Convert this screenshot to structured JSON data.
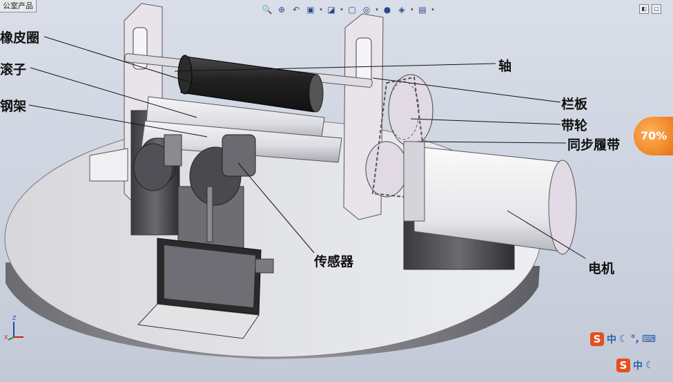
{
  "window": {
    "tab_title": "公室产品"
  },
  "toolbar": {
    "buttons": [
      {
        "icon": "zoom-to-fit-icon",
        "glyph": "🔍"
      },
      {
        "icon": "zoom-area-icon",
        "glyph": "⊕"
      },
      {
        "icon": "previous-view-icon",
        "glyph": "↶"
      },
      {
        "icon": "section-view-icon",
        "glyph": "▣"
      },
      {
        "icon": "view-orientation-icon",
        "glyph": "◪"
      },
      {
        "icon": "display-style-icon",
        "glyph": "▢"
      },
      {
        "icon": "hide-show-icon",
        "glyph": "◎"
      },
      {
        "icon": "appearance-icon",
        "glyph": "●"
      },
      {
        "icon": "scene-icon",
        "glyph": "◈"
      },
      {
        "icon": "view-settings-icon",
        "glyph": "▤"
      }
    ]
  },
  "labels": {
    "rubber_ring": "橡皮圈",
    "roller": "滚子",
    "steel_frame": "钢架",
    "shaft": "轴",
    "baffle": "栏板",
    "pulley": "带轮",
    "timing_belt": "同步履带",
    "sensor": "传感器",
    "motor": "电机"
  },
  "overlay": {
    "progress_text": "70%"
  },
  "ime": {
    "logo": "S",
    "mode": "中",
    "moon": "☾",
    "punct": "°,",
    "keyboard": "⌨"
  },
  "triad": {
    "z": "Z",
    "x": "X"
  }
}
